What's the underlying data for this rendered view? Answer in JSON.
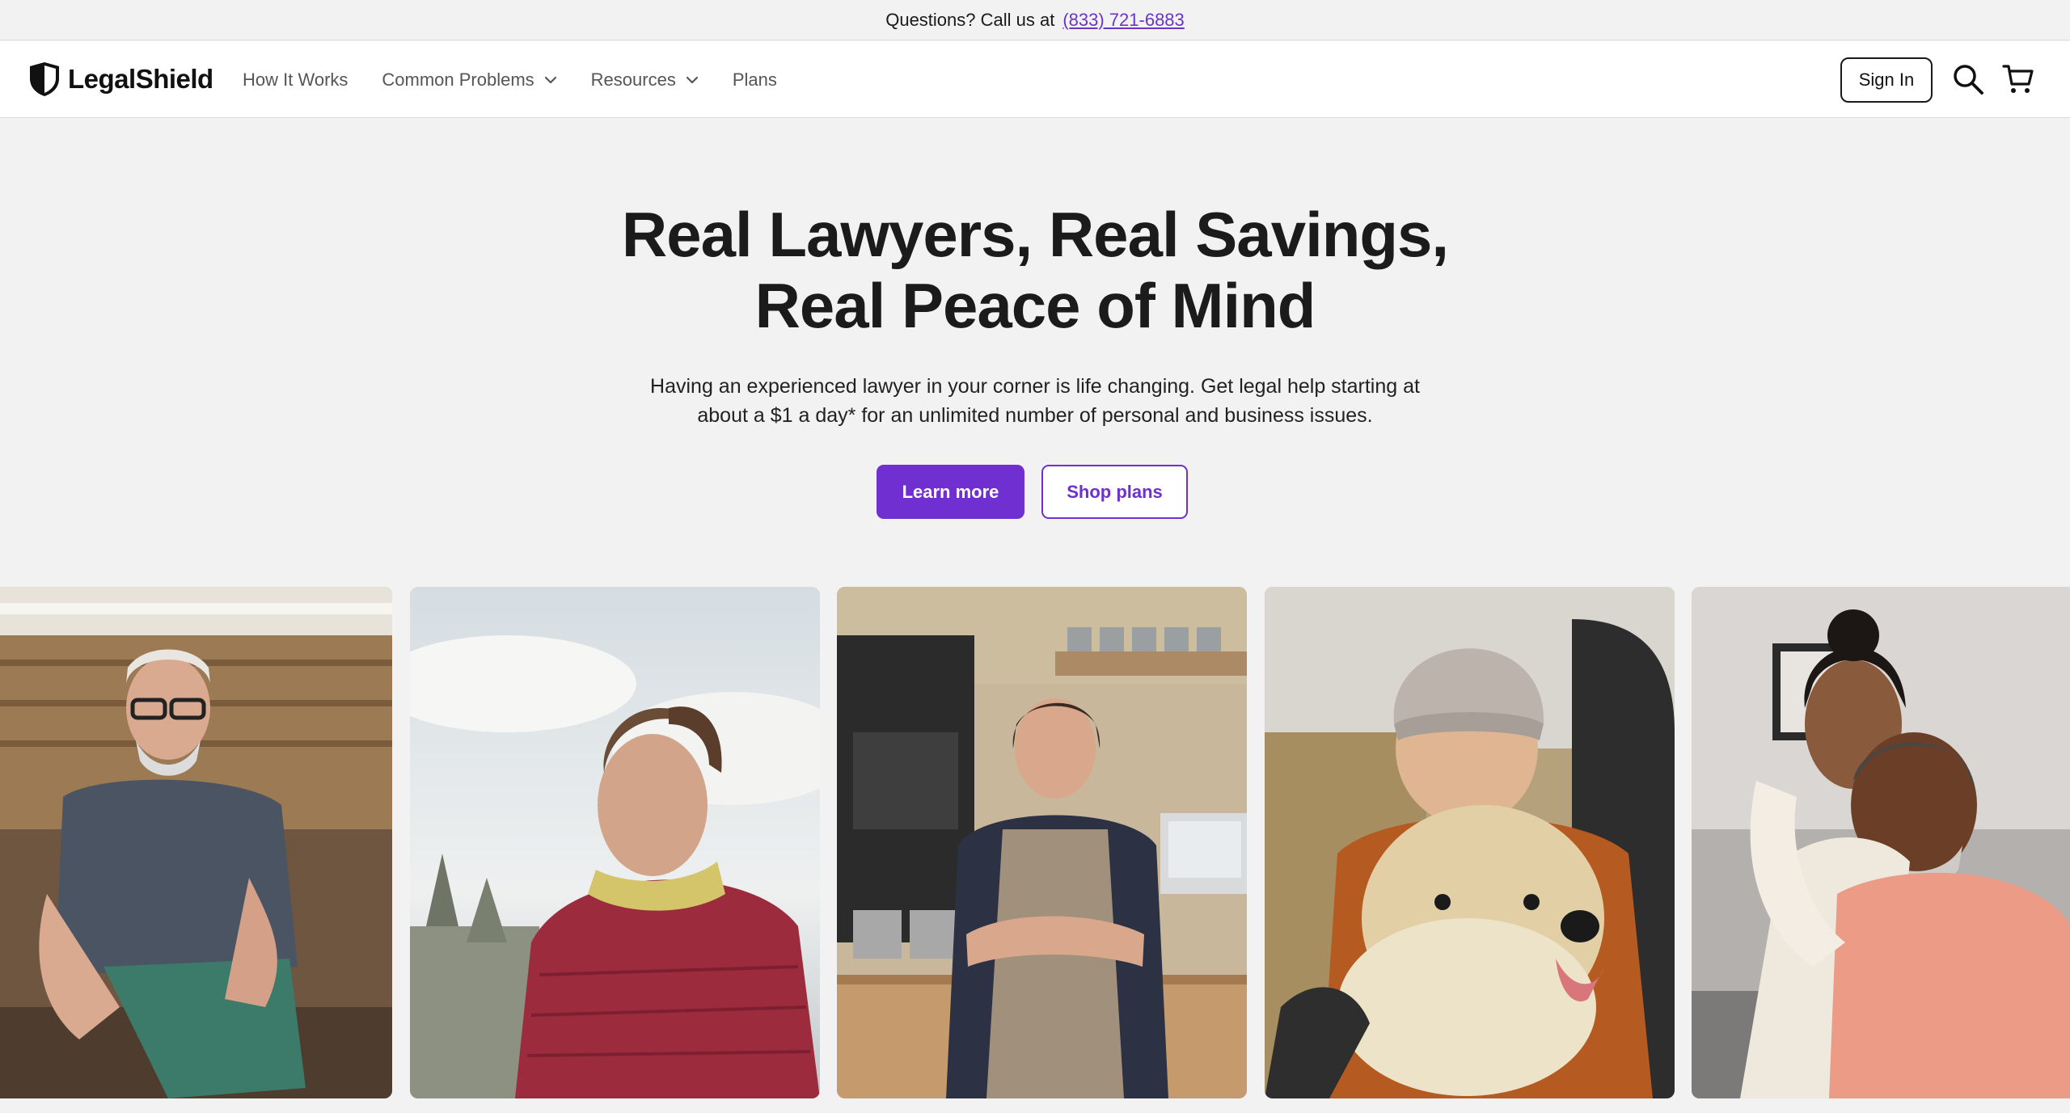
{
  "announcement": {
    "text": "Questions? Call us at",
    "phone": "(833) 721-6883"
  },
  "brand": {
    "name": "LegalShield",
    "accent": "#6f2fd1"
  },
  "nav": {
    "items": [
      {
        "label": "How It Works"
      },
      {
        "label": "Common Problems"
      },
      {
        "label": "Resources"
      },
      {
        "label": "Plans"
      }
    ]
  },
  "header": {
    "signin_label": "Sign In",
    "search_icon": "search-icon",
    "cart_icon": "cart-icon"
  },
  "hero": {
    "title_line1": "Real Lawyers, Real Savings,",
    "title_line2": "Real Peace of Mind",
    "subtitle_line1": "Having an experienced lawyer in your corner is life changing. Get legal help starting at",
    "subtitle_line2": "about a $1 a day* for an unlimited number of personal and business issues.",
    "primary_cta": "Learn more",
    "secondary_cta": "Shop plans"
  },
  "photos": [
    {
      "subject": "older man with glasses sitting on wooden deck"
    },
    {
      "subject": "woman in red puffer jacket looking up at sky"
    },
    {
      "subject": "woman in apron standing in cafe"
    },
    {
      "subject": "woman in knit beanie hugging fluffy dog"
    },
    {
      "subject": "couple embracing on sofa"
    }
  ]
}
